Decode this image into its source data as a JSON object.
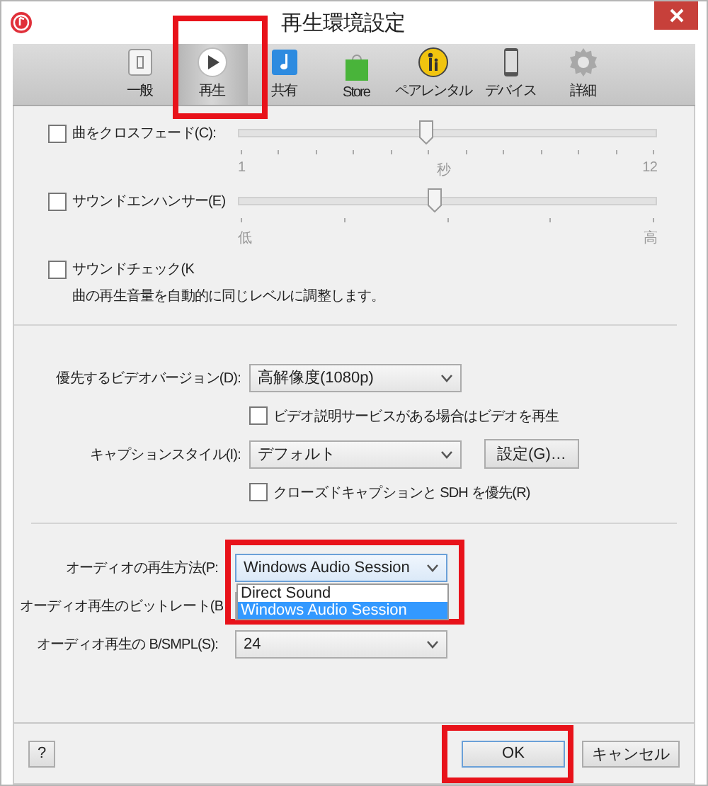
{
  "window": {
    "title": "再生環境設定"
  },
  "toolbar": [
    {
      "label": "一般",
      "selected": false,
      "highlighted": false
    },
    {
      "label": "再生",
      "selected": true,
      "highlighted": true
    },
    {
      "label": "共有",
      "selected": false,
      "highlighted": false
    },
    {
      "label": "Store",
      "selected": false,
      "highlighted": false
    },
    {
      "label": "ペアレンタル",
      "selected": false,
      "highlighted": false
    },
    {
      "label": "デバイス",
      "selected": false,
      "highlighted": false
    },
    {
      "label": "詳細",
      "selected": false,
      "highlighted": false
    }
  ],
  "sound_options": [
    {
      "kind": "slider",
      "label": "曲をクロスフェード(C):",
      "checked": false,
      "level": 0.45,
      "scale": [
        "1",
        "秒",
        "12"
      ]
    },
    {
      "kind": "slider",
      "label": "サウンドエンハンサー(E)",
      "checked": false,
      "level": 0.47,
      "scale": [
        "低",
        "高"
      ]
    },
    {
      "kind": "check",
      "label": "サウンドチェック(K",
      "checked": false,
      "description": "曲の再生音量を自動的に同じレベルに調整します。"
    }
  ],
  "video_options": [
    {
      "kind": "select",
      "label": "優先するビデオバージョン(D):",
      "value": "高解像度(1080p)"
    },
    {
      "kind": "check",
      "label": "ビデオ説明サービスがある場合はビデオを再生",
      "checked": false
    },
    {
      "kind": "select",
      "label": "キャプションスタイル(I):",
      "value": "デフォルト",
      "button": "設定(G)…"
    },
    {
      "kind": "check",
      "label": "クローズドキャプションと SDH を優先(R)",
      "checked": false
    }
  ],
  "audio_options": [
    {
      "kind": "select",
      "label": "オーディオの再生方法(P:",
      "value": "Windows Audio Session",
      "highlighted": true,
      "options": [
        {
          "label": "Direct Sound",
          "selected": false
        },
        {
          "label": "Windows Audio Session",
          "selected": true
        }
      ]
    },
    {
      "kind": "select",
      "label": "オーディオ再生のビットレート(B"
    },
    {
      "kind": "select",
      "label": "オーディオ再生の B/SMPL(S):",
      "value": "24"
    }
  ],
  "buttons": [
    {
      "kind": "help",
      "label": "?",
      "default": false,
      "highlighted": false
    },
    {
      "kind": "action",
      "label": "OK",
      "default": true,
      "highlighted": true
    },
    {
      "kind": "action",
      "label": "キャンセル",
      "default": false,
      "highlighted": false
    }
  ]
}
